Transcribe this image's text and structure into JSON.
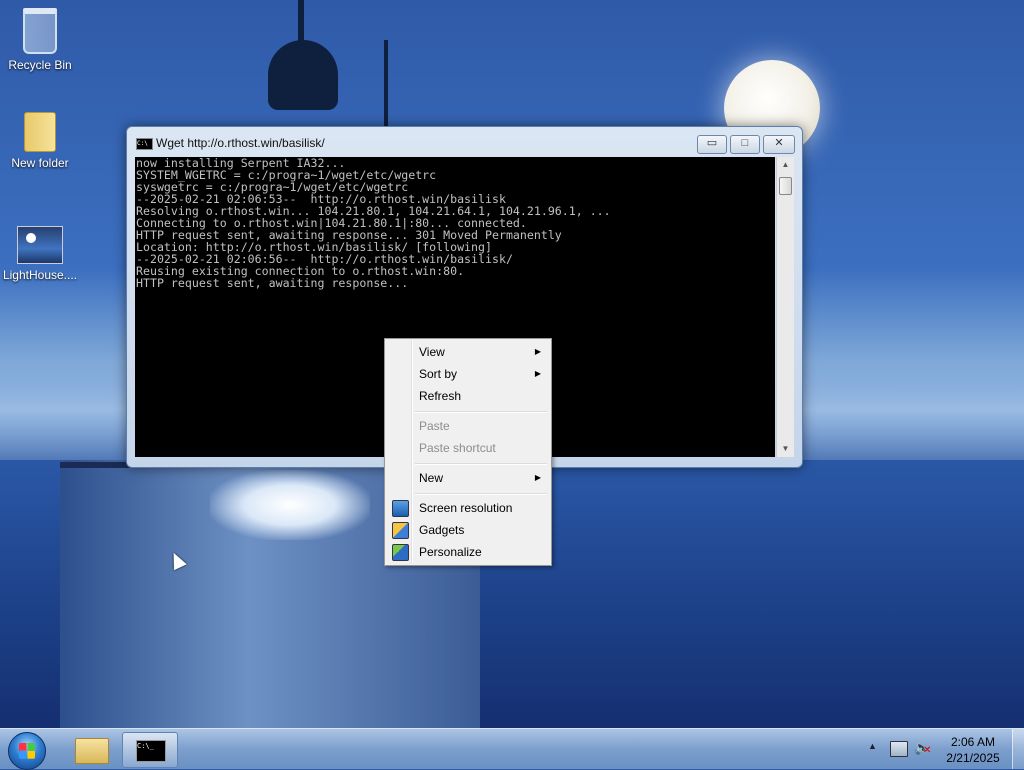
{
  "desktop": {
    "icons": [
      {
        "label": "Recycle Bin",
        "icon": "recycle-bin-icon"
      },
      {
        "label": "New folder",
        "icon": "folder-icon"
      },
      {
        "label": "LightHouse....",
        "icon": "image-file-icon"
      }
    ]
  },
  "window": {
    "title": "Wget http://o.rthost.win/basilisk/",
    "icon": "console-icon",
    "buttons": {
      "minimize": "▭",
      "maximize": "□",
      "close": "✕"
    },
    "console_lines": [
      "now installing Serpent IA32...",
      "",
      "SYSTEM_WGETRC = c:/progra~1/wget/etc/wgetrc",
      "syswgetrc = c:/progra~1/wget/etc/wgetrc",
      "--2025-02-21 02:06:53--  http://o.rthost.win/basilisk",
      "Resolving o.rthost.win... 104.21.80.1, 104.21.64.1, 104.21.96.1, ...",
      "Connecting to o.rthost.win|104.21.80.1|:80... connected.",
      "HTTP request sent, awaiting response... 301 Moved Permanently",
      "Location: http://o.rthost.win/basilisk/ [following]",
      "--2025-02-21 02:06:56--  http://o.rthost.win/basilisk/",
      "Reusing existing connection to o.rthost.win:80.",
      "HTTP request sent, awaiting response..."
    ]
  },
  "context_menu": {
    "items": [
      {
        "label": "View",
        "submenu": true,
        "disabled": false
      },
      {
        "label": "Sort by",
        "submenu": true,
        "disabled": false
      },
      {
        "label": "Refresh",
        "submenu": false,
        "disabled": false
      },
      {
        "label": "Paste",
        "submenu": false,
        "disabled": true
      },
      {
        "label": "Paste shortcut",
        "submenu": false,
        "disabled": true
      },
      {
        "label": "New",
        "submenu": true,
        "disabled": false
      },
      {
        "label": "Screen resolution",
        "submenu": false,
        "disabled": false,
        "icon": "monitor-icon"
      },
      {
        "label": "Gadgets",
        "submenu": false,
        "disabled": false,
        "icon": "gadgets-icon"
      },
      {
        "label": "Personalize",
        "submenu": false,
        "disabled": false,
        "icon": "personalize-icon"
      }
    ],
    "submenu_arrow": "▶"
  },
  "taskbar": {
    "cmd_icon_text": "C:\\_",
    "tray_arrow": "▲",
    "clock": {
      "time": "2:06 AM",
      "date": "2/21/2025"
    }
  },
  "colors": {
    "console_bg": "#000000",
    "console_text": "#c0c0c0",
    "menu_bg": "#f0f0f0"
  }
}
